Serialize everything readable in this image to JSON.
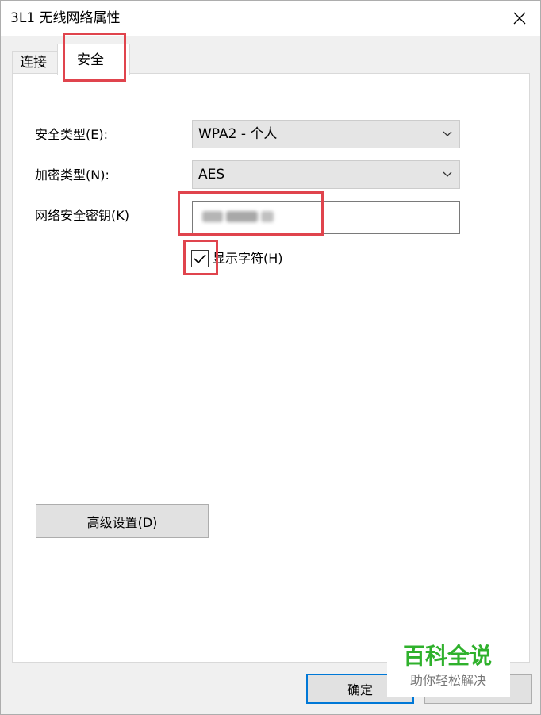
{
  "window": {
    "title": "3L1 无线网络属性",
    "close_icon": "close-icon"
  },
  "tabs": [
    {
      "label": "连接",
      "selected": false
    },
    {
      "label": "安全",
      "selected": true
    }
  ],
  "security": {
    "security_type_label": "安全类型(E):",
    "security_type_value": "WPA2 - 个人",
    "encryption_type_label": "加密类型(N):",
    "encryption_type_value": "AES",
    "network_key_label": "网络安全密钥(K)",
    "show_characters_label": "显示字符(H)",
    "show_characters_checked": true
  },
  "buttons": {
    "advanced_settings": "高级设置(D)",
    "ok": "确定",
    "cancel": ""
  },
  "watermark": {
    "main": "百科全说",
    "sub": "助你轻松解决"
  },
  "colors": {
    "highlight": "#e0444d",
    "watermark_green": "#2fb12c",
    "focus_blue": "#0078d7"
  }
}
